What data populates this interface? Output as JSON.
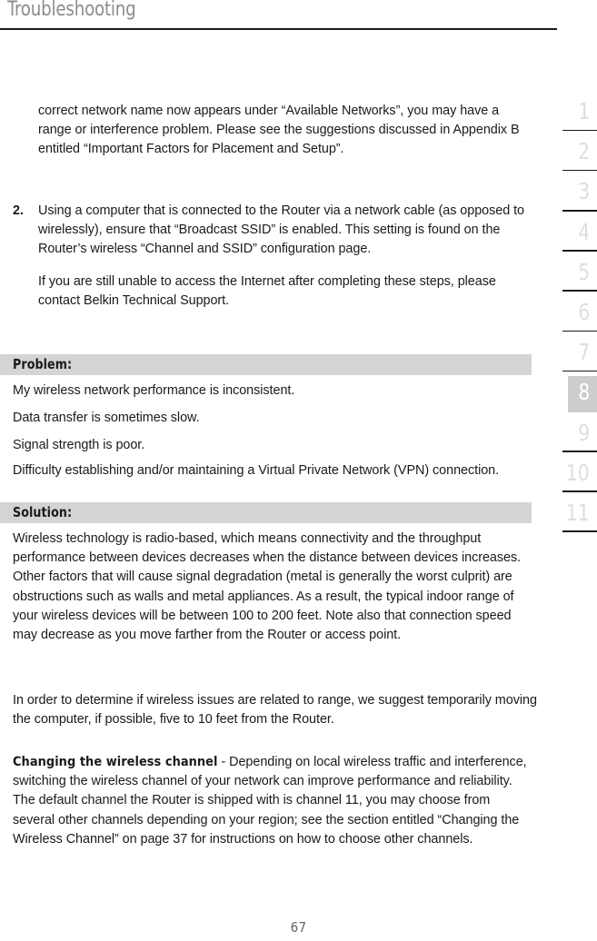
{
  "header": {
    "title": "Troubleshooting"
  },
  "content": {
    "continued_paragraph": "correct network name now appears under “Available Networks”, you may have a range or interference problem. Please see the suggestions discussed in Appendix B entitled “Important Factors for Placement and Setup”.",
    "list_item_2": {
      "marker": "2.",
      "text": "Using a computer that is connected to the Router via a network cable (as opposed to wirelessly), ensure that “Broadcast SSID” is enabled. This setting is found on the Router’s wireless “Channel and SSID” configuration page.",
      "follow_up": "If you are still unable to access the Internet after completing these steps, please contact Belkin Technical Support."
    },
    "problem": {
      "bar_label": "Problem:",
      "lines": [
        "My wireless network performance is inconsistent.",
        "Data transfer is sometimes slow.",
        "Signal strength is poor.",
        "Difficulty establishing and/or maintaining a Virtual Private Network (VPN) connection."
      ]
    },
    "solution": {
      "bar_label": "Solution:",
      "paragraph_1": "Wireless technology is radio-based, which means connectivity and the throughput performance between devices decreases when the distance between devices increases. Other factors that will cause signal degradation (metal is generally the worst culprit) are obstructions such as walls and metal appliances. As a result, the typical indoor range of your wireless devices will be between 100 to 200 feet. Note also that connection speed may decrease as you move farther from the Router or access point.",
      "paragraph_2": "In order to determine if wireless issues are related to range, we suggest temporarily moving the computer, if possible, five to 10 feet from the Router.",
      "paragraph_3_lead": "Changing the wireless channel",
      "paragraph_3_rest": " - Depending on local wireless traffic and interference, switching the wireless channel of your network can improve performance and reliability. The default channel the Router is shipped with is channel 11, you may choose from several other channels depending on your region; see the section entitled “Changing the Wireless Channel” on page 37 for instructions on how to choose other channels."
    }
  },
  "section_index": {
    "tabs": [
      {
        "label": "1",
        "active": false
      },
      {
        "label": "2",
        "active": false
      },
      {
        "label": "3",
        "active": false
      },
      {
        "label": "4",
        "active": false
      },
      {
        "label": "5",
        "active": false
      },
      {
        "label": "6",
        "active": false
      },
      {
        "label": "7",
        "active": false
      },
      {
        "label": "8",
        "active": true
      },
      {
        "label": "9",
        "active": false
      },
      {
        "label": "10",
        "active": false
      },
      {
        "label": "11",
        "active": false
      }
    ]
  },
  "footer": {
    "page_number": "67"
  },
  "colors": {
    "header_title": "#8d8d8d",
    "bar_background": "#d4d4d4",
    "tab_inactive": "#dedede",
    "tab_active_bg": "#cdcdcd",
    "body_text": "#1a1a1a"
  }
}
